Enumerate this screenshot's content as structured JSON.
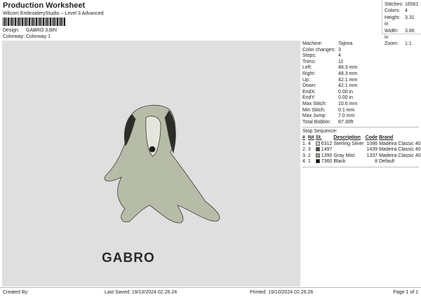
{
  "header": {
    "title": "Production Worksheet",
    "subtitle": "Wilcom EmbroideryStudio – Level 3 Advanced",
    "design_label": "Design:",
    "design_value": "GABRO 3,8IN",
    "colorway_label": "Colorway:",
    "colorway_value": "Colorway 1"
  },
  "summary": [
    {
      "k": "Stitches:",
      "v": "16561"
    },
    {
      "k": "Colors:",
      "v": "4"
    },
    {
      "k": "Height:",
      "v": "3.31 in"
    },
    {
      "k": "Width:",
      "v": "3.80 in"
    },
    {
      "k": "Zoom:",
      "v": "1:1"
    }
  ],
  "design_text": "GABRO",
  "details": [
    {
      "k": "Machine:",
      "v": "Tajima"
    },
    {
      "k": "Color changes:",
      "v": "3"
    },
    {
      "k": "Stops:",
      "v": "4"
    },
    {
      "k": "Trims:",
      "v": "11"
    },
    {
      "k": "Left:",
      "v": "48.3 mm"
    },
    {
      "k": "Right:",
      "v": "48.3 mm"
    },
    {
      "k": "Up:",
      "v": "42.1 mm"
    },
    {
      "k": "Down:",
      "v": "42.1 mm"
    },
    {
      "k": "EndX:",
      "v": "0.00 in"
    },
    {
      "k": "EndY:",
      "v": "0.00 in"
    },
    {
      "k": "Max Stitch:",
      "v": "10.6 mm"
    },
    {
      "k": "Min Stitch:",
      "v": "0.1 mm"
    },
    {
      "k": "Max Jump:",
      "v": "7.0 mm"
    },
    {
      "k": "Total Bobbin:",
      "v": "87.30ft"
    }
  ],
  "stop_sequence": {
    "label": "Stop Sequence:",
    "headers": [
      "#",
      "N#",
      "St.",
      "Description",
      "Code",
      "Brand"
    ],
    "rows": [
      {
        "n": "1.",
        "nn": "4",
        "color": "#d0d0cc",
        "st": "6312",
        "desc": "Sterling Silver",
        "code": "1086",
        "brand": "Madeira Classic 40"
      },
      {
        "n": "2.",
        "nn": "3",
        "color": "#4a4a4a",
        "st": "1497",
        "desc": "",
        "code": "1439",
        "brand": "Madeira Classic 40"
      },
      {
        "n": "3.",
        "nn": "2",
        "color": "#9c9e8c",
        "st": "1390",
        "desc": "Gray Mist",
        "code": "1337",
        "brand": "Madeira Classic 40"
      },
      {
        "n": "4.",
        "nn": "1",
        "color": "#000000",
        "st": "7360",
        "desc": "Black",
        "code": "8",
        "brand": "Default"
      }
    ]
  },
  "footer": {
    "created": "Created By:",
    "saved": "Last Saved: 19/10/2024 02.26.24",
    "printed": "Printed: 19/10/2024 02.26.26",
    "page": "Page 1 of 1"
  }
}
